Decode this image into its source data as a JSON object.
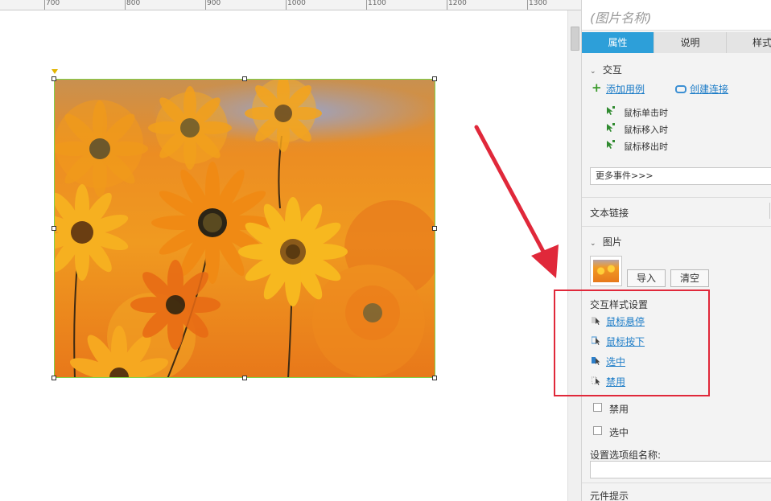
{
  "ruler": {
    "labels": [
      "700",
      "800",
      "900",
      "1000",
      "1100",
      "1200",
      "1300"
    ]
  },
  "panel": {
    "title": "(图片名称)",
    "tabs": [
      "属性",
      "说明",
      "样式"
    ],
    "interaction": {
      "heading": "交互",
      "add_case": "添加用例",
      "create_link": "创建连接",
      "events": [
        "鼠标单击时",
        "鼠标移入时",
        "鼠标移出时"
      ],
      "more_events": "更多事件>>>"
    },
    "text_link": "文本链接",
    "image": {
      "heading": "图片",
      "import_button": "导入",
      "clear_button": "清空"
    },
    "interaction_styles": {
      "heading": "交互样式设置",
      "items": [
        "鼠标悬停",
        "鼠标按下",
        "选中",
        "禁用"
      ]
    },
    "checkboxes": [
      "禁用",
      "选中"
    ],
    "group_name_label": "设置选项组名称:",
    "tooltip_label": "元件提示"
  },
  "colors": {
    "tab_active": "#2d9fd9",
    "link": "#1c7cc7",
    "annotation_red": "#e0283a",
    "selection_green": "#7dd34a"
  }
}
